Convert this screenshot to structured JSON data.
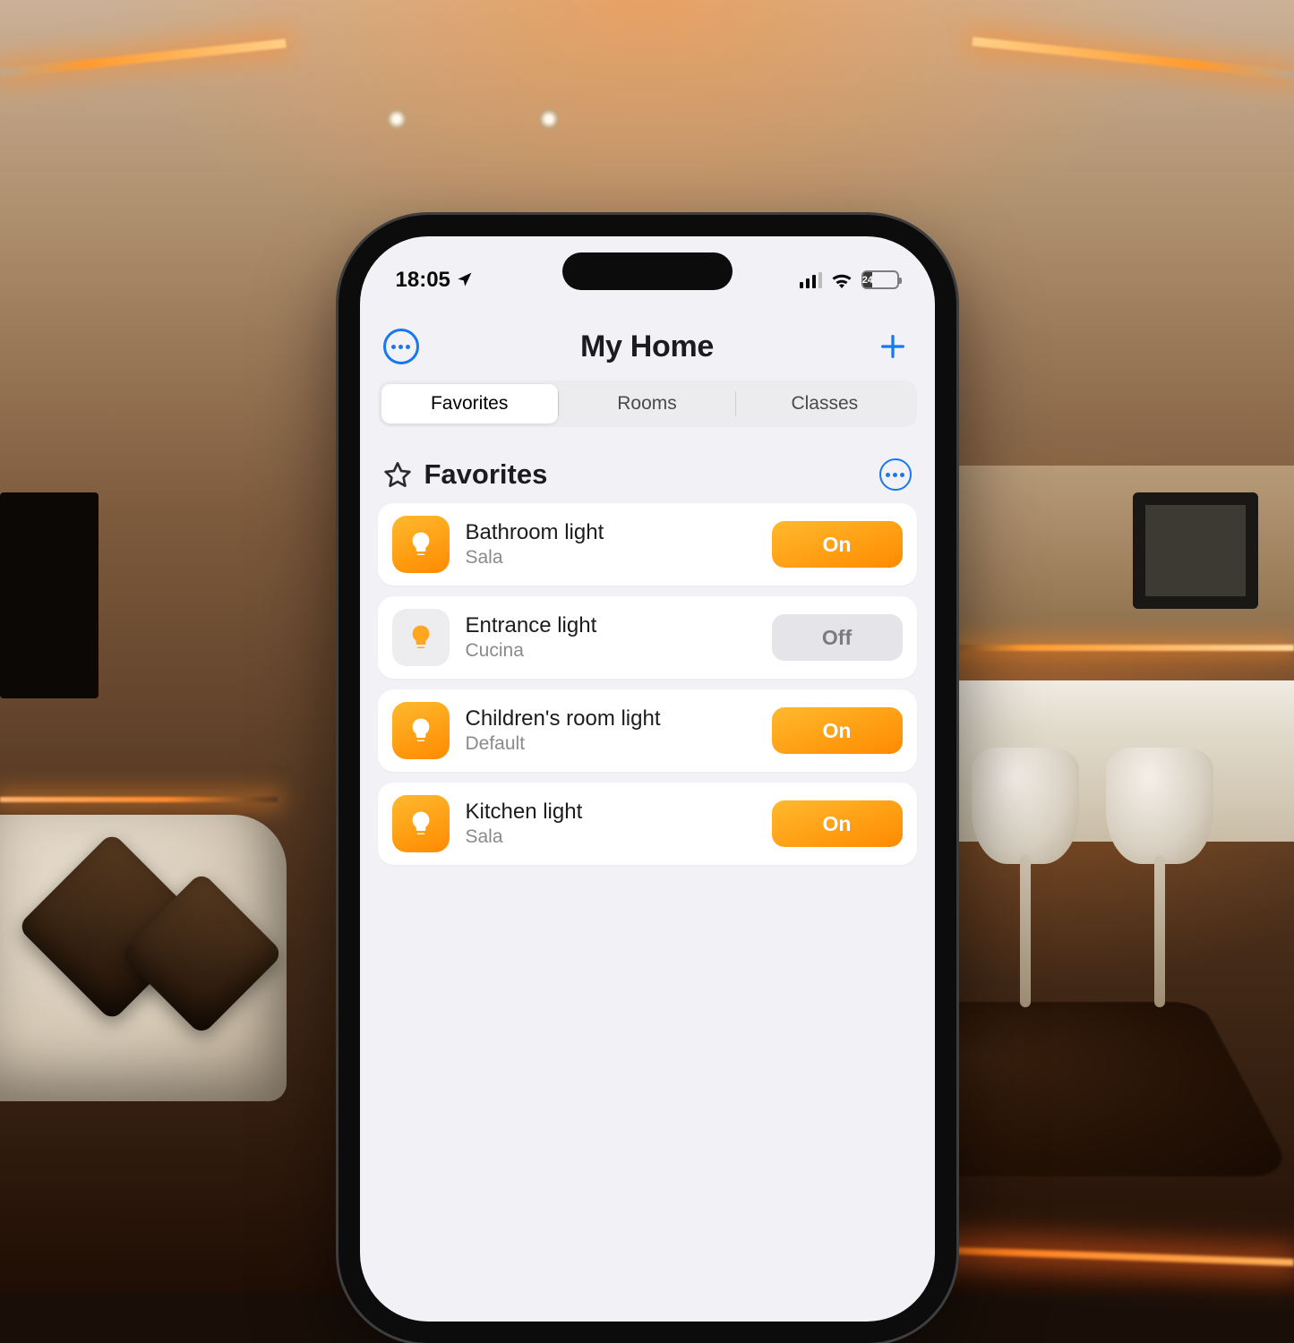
{
  "status": {
    "time": "18:05",
    "battery_label": "24"
  },
  "header": {
    "title": "My Home"
  },
  "tabs": {
    "favorites": "Favorites",
    "rooms": "Rooms",
    "classes": "Classes",
    "active": "favorites"
  },
  "section": {
    "title": "Favorites"
  },
  "devices": [
    {
      "name": "Bathroom light",
      "room": "Sala",
      "state": "On",
      "on": true
    },
    {
      "name": "Entrance light",
      "room": "Cucina",
      "state": "Off",
      "on": false
    },
    {
      "name": "Children's room light",
      "room": "Default",
      "state": "On",
      "on": true
    },
    {
      "name": "Kitchen light",
      "room": "Sala",
      "state": "On",
      "on": true
    }
  ],
  "colors": {
    "accent": "#1877F2",
    "gradient_start": "#FFB92E",
    "gradient_end": "#FF8A00"
  }
}
